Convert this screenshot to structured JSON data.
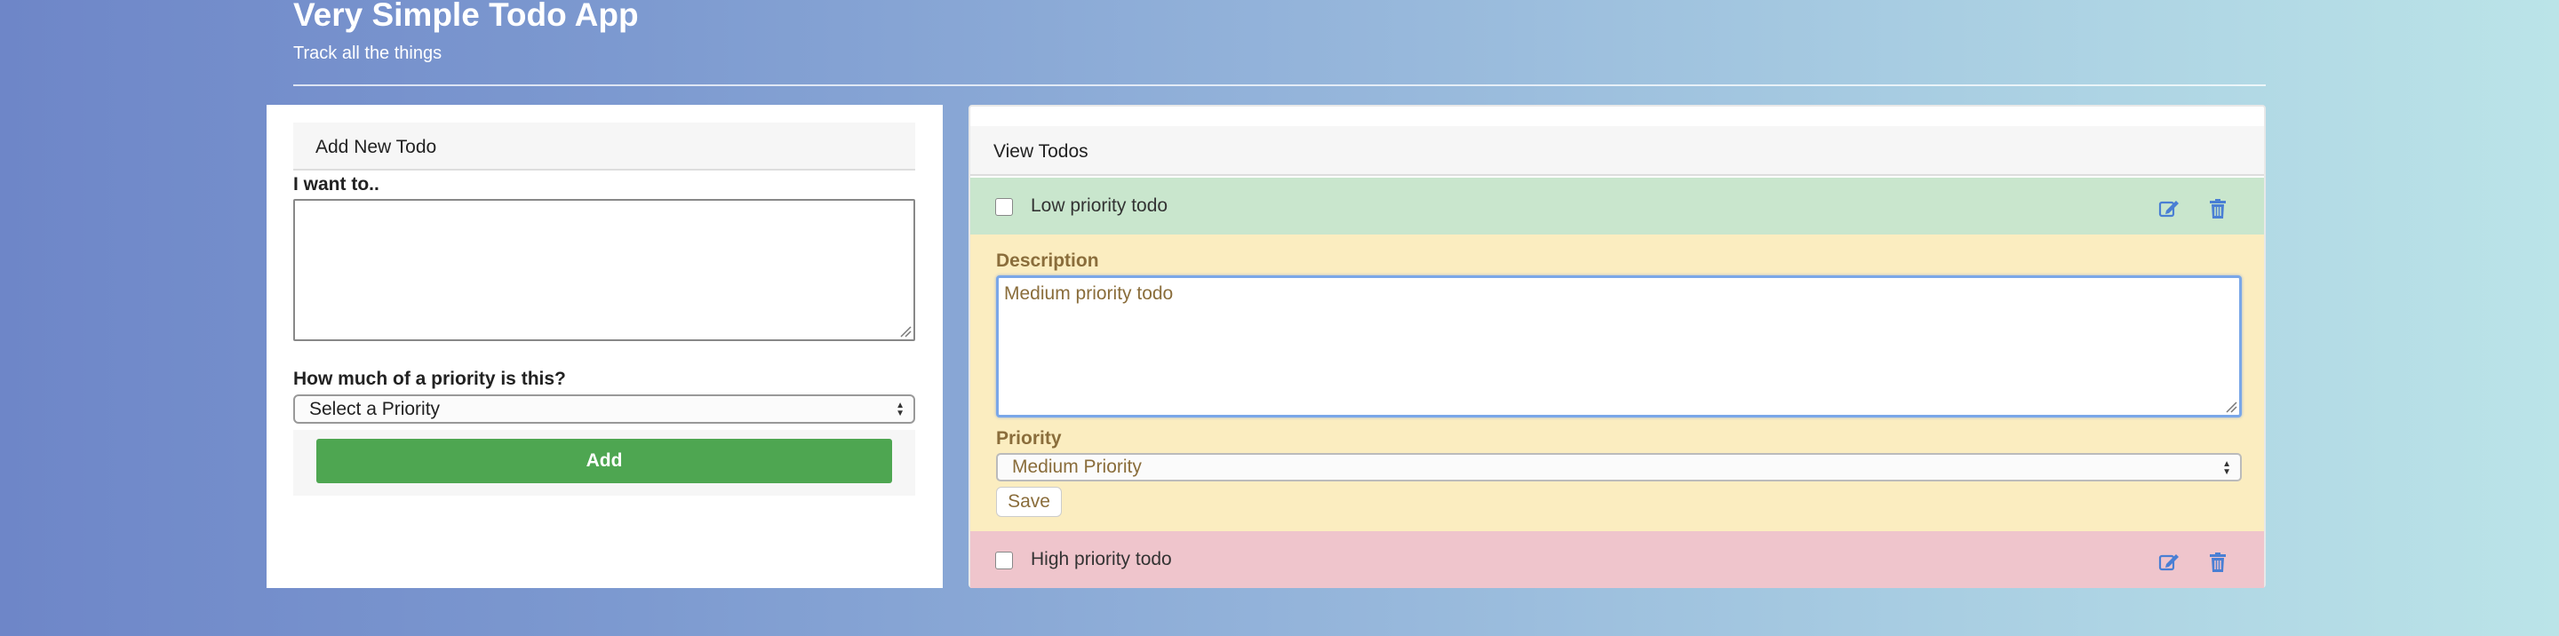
{
  "app": {
    "title": "Very Simple Todo App",
    "subtitle": "Track all the things"
  },
  "add_panel": {
    "header": "Add New Todo",
    "todo_label": "I want to..",
    "todo_value": "",
    "priority_label": "How much of a priority is this?",
    "priority_selected": "Select a Priority",
    "add_button": "Add"
  },
  "view_panel": {
    "header": "View Todos",
    "todos": [
      {
        "text": "Low priority todo",
        "priority": "low",
        "checked": false,
        "color": "#c9e6cd"
      },
      {
        "text": "High priority todo",
        "priority": "high",
        "checked": false,
        "color": "#efc5cc"
      }
    ],
    "editing": {
      "description_label": "Description",
      "description_value": "Medium priority todo",
      "priority_label": "Priority",
      "priority_selected": "Medium Priority",
      "save_button": "Save",
      "color": "#fbedc0"
    }
  },
  "icons": {
    "edit": "edit-icon",
    "delete": "trash-icon"
  },
  "colors": {
    "accent_blue": "#4a7fd4",
    "add_green": "#4ea651",
    "text_brown": "#8a6d3b"
  }
}
